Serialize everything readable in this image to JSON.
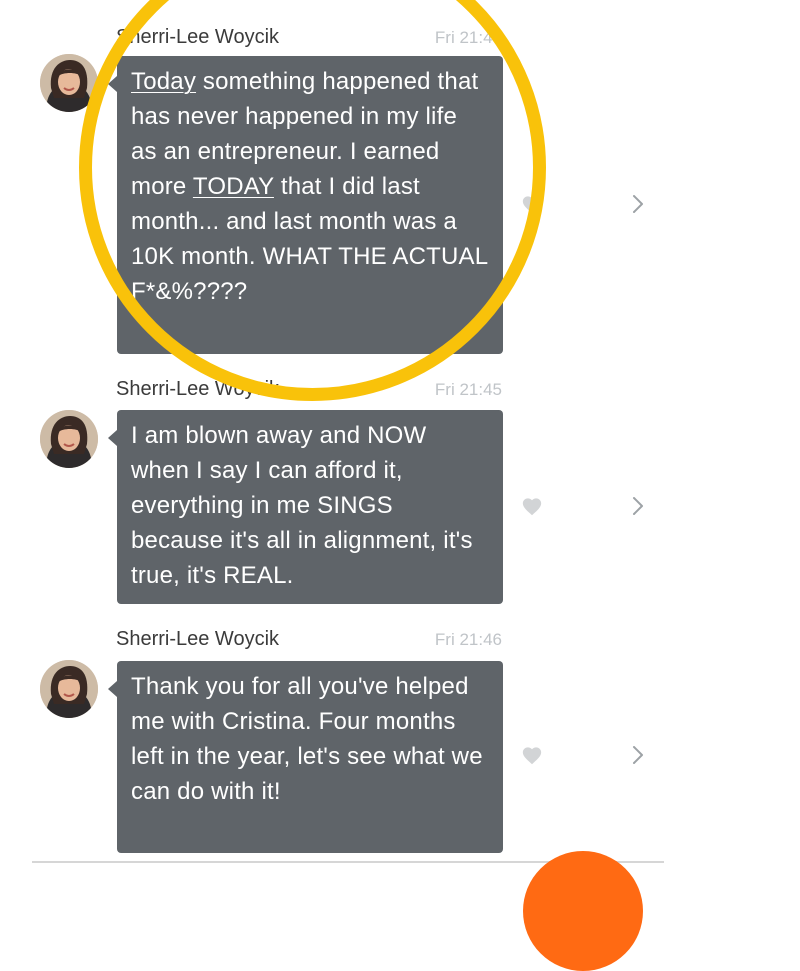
{
  "messages": [
    {
      "sender": "Sherri-Lee Woycik",
      "time": "Fri 21:45",
      "segments": [
        {
          "text": "Today",
          "underline": true
        },
        {
          "text": " something happened that has never happened in my life as an entrepreneur. I earned more ",
          "underline": false
        },
        {
          "text": "TODAY",
          "underline": true
        },
        {
          "text": " that I did last month... and last month was a 10K month. WHAT THE ACTUAL F*&%????",
          "underline": false
        }
      ]
    },
    {
      "sender": "Sherri-Lee Woycik",
      "time": "Fri 21:45",
      "segments": [
        {
          "text": "I am blown away and NOW when I say I can afford it, everything in me SINGS because it's all in alignment, it's true, it's REAL.",
          "underline": false
        }
      ]
    },
    {
      "sender": "Sherri-Lee Woycik",
      "time": "Fri 21:46",
      "segments": [
        {
          "text": "Thank you for all you've helped me with Cristina. Four months left in the year, let's see what we can do with it!",
          "underline": false
        }
      ]
    }
  ],
  "icons": {
    "like": "heart-icon",
    "more": "chevron-right-icon"
  },
  "colors": {
    "bubble": "#5f6469",
    "highlight_ring": "#f9c20a",
    "fab": "#ff6a13",
    "timestamp": "#c0c4c8"
  }
}
